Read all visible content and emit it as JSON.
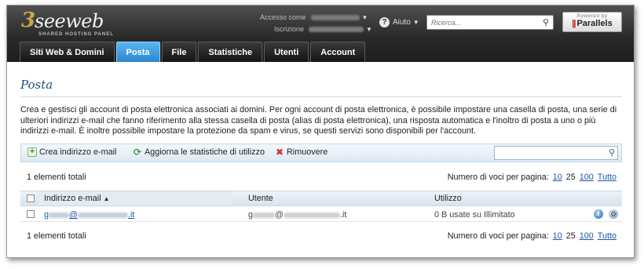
{
  "header": {
    "logo_mark": "3",
    "logo_name": "seeweb",
    "logo_sub": "SHARED HOSTING PANEL",
    "account_label": "Accesso come",
    "subscription_label": "Iscrizione",
    "help_label": "Aiuto",
    "search_placeholder": "Ricerca...",
    "powered_by": "Powered by",
    "powered_brand": "Parallels"
  },
  "tabs": [
    {
      "label": "Siti Web & Domini",
      "active": false
    },
    {
      "label": "Posta",
      "active": true
    },
    {
      "label": "File",
      "active": false
    },
    {
      "label": "Statistiche",
      "active": false
    },
    {
      "label": "Utenti",
      "active": false
    },
    {
      "label": "Account",
      "active": false
    }
  ],
  "page": {
    "title": "Posta",
    "description": "Crea e gestisci gli account di posta elettronica associati ai domini. Per ogni account di posta elettronica, è possibile impostare una casella di posta, una serie di ulteriori indirizzi e-mail che fanno riferimento alla stessa casella di posta (alias di posta elettronica), una risposta automatica e l'inoltro di posta a uno o più indirizzi e-mail. È inoltre possibile impostare la protezione da spam e virus, se questi servizi sono disponibili per l'account."
  },
  "toolbar": {
    "create_label": "Crea indirizzo e-mail",
    "refresh_label": "Aggiorna le statistiche di utilizzo",
    "remove_label": "Rimuovere"
  },
  "list": {
    "total_label": "1 elementi totali",
    "per_page_label": "Numero di voci per pagina:",
    "per_page_options": [
      "10",
      "25",
      "100",
      "Tutto"
    ],
    "per_page_current": "25",
    "columns": {
      "email": "Indirizzo e-mail",
      "user": "Utente",
      "usage": "Utilizzo"
    },
    "rows": [
      {
        "email_prefix": "g",
        "email_domain_mid": "@",
        "email_tld": ".it",
        "user_prefix": "g",
        "user_at": "@",
        "user_tld": ".it",
        "usage": "0 B usate su Illimitato"
      }
    ]
  },
  "icons": {
    "sort": "sort-ascending-icon",
    "info": "info-icon",
    "settings": "mail-settings-icon",
    "search": "search-icon"
  }
}
